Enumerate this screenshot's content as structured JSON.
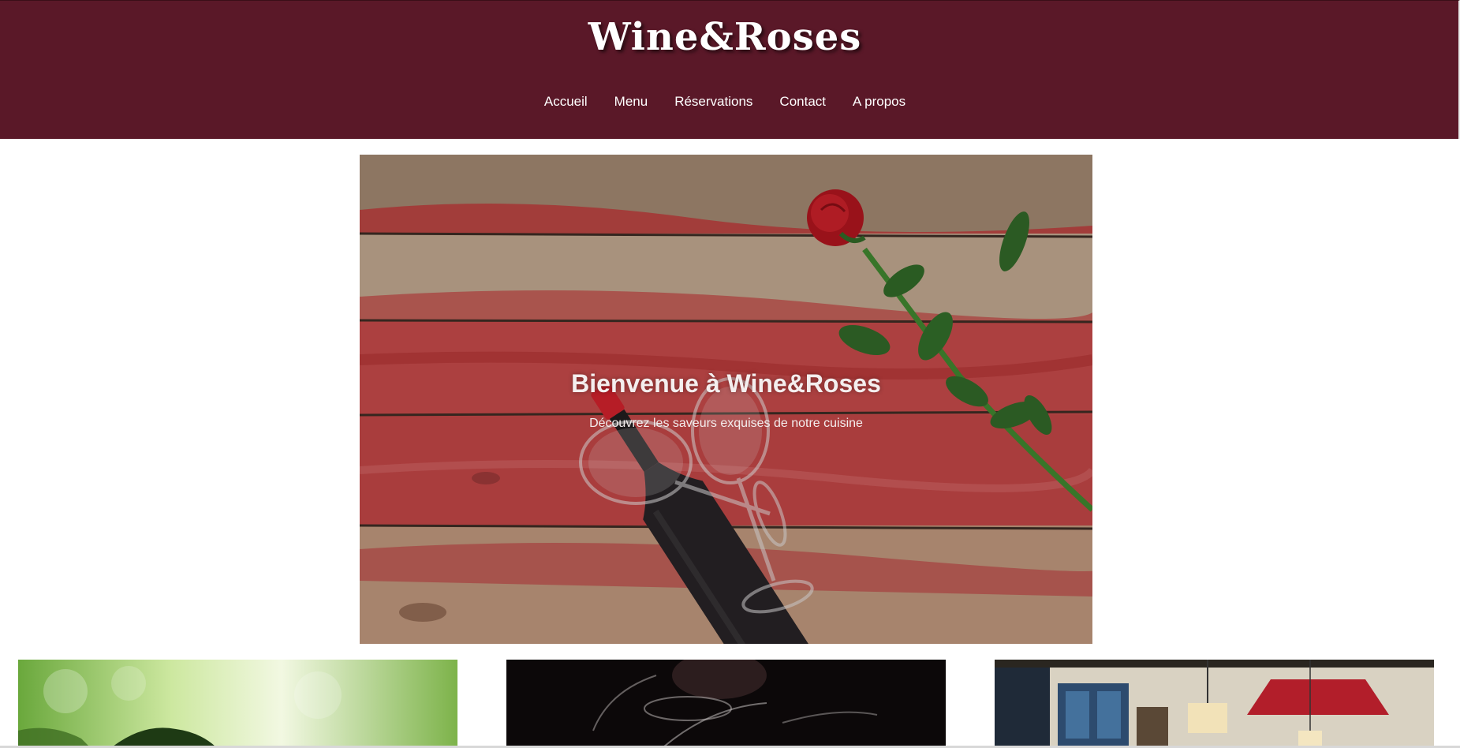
{
  "header": {
    "brand": "Wine&Roses",
    "nav": [
      {
        "label": "Accueil"
      },
      {
        "label": "Menu"
      },
      {
        "label": "Réservations"
      },
      {
        "label": "Contact"
      },
      {
        "label": "A propos"
      }
    ]
  },
  "hero": {
    "title": "Bienvenue à Wine&Roses",
    "subtitle": "Découvrez les saveurs exquises de notre cuisine"
  },
  "cards": [
    {
      "image": "green-vineyard-photo"
    },
    {
      "image": "wine-glasses-toast-photo"
    },
    {
      "image": "restaurant-interior-photo"
    }
  ],
  "colors": {
    "header_bg": "#5a1828",
    "accent_red": "#c0392b"
  }
}
